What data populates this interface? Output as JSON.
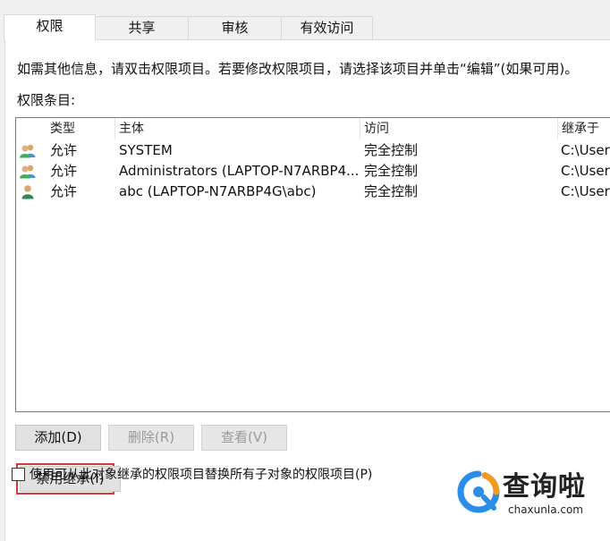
{
  "tabs": [
    {
      "label": "权限",
      "active": true
    },
    {
      "label": "共享",
      "active": false
    },
    {
      "label": "审核",
      "active": false
    },
    {
      "label": "有效访问",
      "active": false
    }
  ],
  "info_text": "如需其他信息，请双击权限项目。若要修改权限项目，请选择该项目并单击“编辑”(如果可用)。",
  "list_label": "权限条目:",
  "columns": [
    "类型",
    "主体",
    "访问",
    "继承于"
  ],
  "rows": [
    {
      "type": "允许",
      "principal": "SYSTEM",
      "access": "完全控制",
      "inherited": "C:\\Users",
      "icon": "group-user-icon"
    },
    {
      "type": "允许",
      "principal": "Administrators (LAPTOP-N7ARBP4...",
      "access": "完全控制",
      "inherited": "C:\\Users",
      "icon": "group-user-icon"
    },
    {
      "type": "允许",
      "principal": "abc (LAPTOP-N7ARBP4G\\abc)",
      "access": "完全控制",
      "inherited": "C:\\Users",
      "icon": "single-user-icon"
    }
  ],
  "buttons": {
    "add": "添加(D)",
    "remove": "删除(R)",
    "view": "查看(V)",
    "disable_inheritance": "禁用继承(I)"
  },
  "replace_checkbox": {
    "label": "使用可从此对象继承的权限项目替换所有子对象的权限项目(P)",
    "checked": false
  },
  "watermark": {
    "name": "查询啦",
    "site": "chaxunla.com"
  },
  "colors": {
    "highlight": "#d23b3b",
    "watermark_blue": "#2a8de8",
    "watermark_orange": "#f39a1e"
  }
}
